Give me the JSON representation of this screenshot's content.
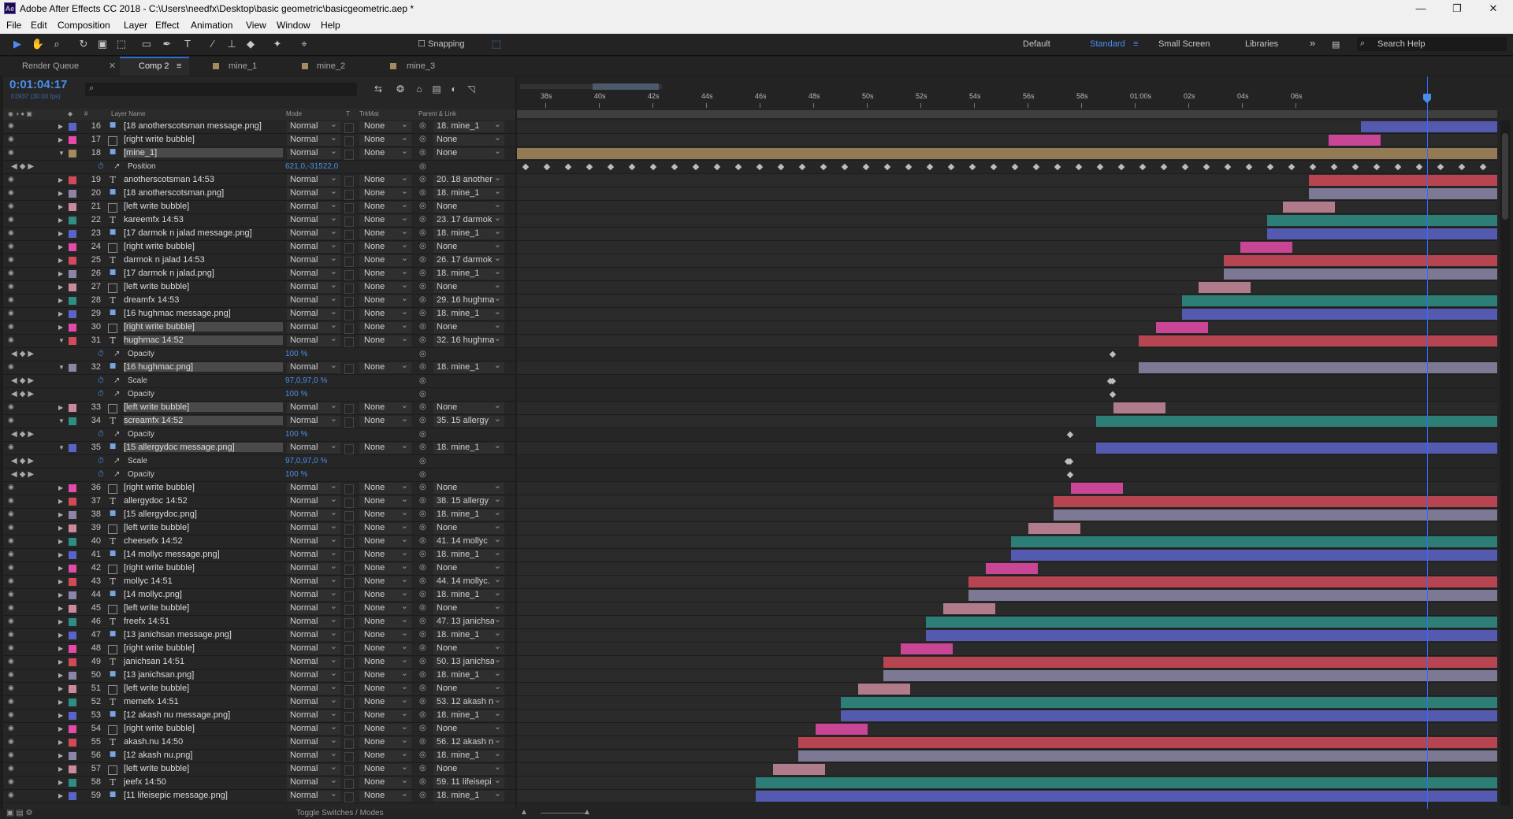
{
  "window": {
    "title": "Adobe After Effects CC 2018 - C:\\Users\\needfx\\Desktop\\basic geometric\\basicgeometric.aep *",
    "app_icon": "Ae"
  },
  "menu": [
    "File",
    "Edit",
    "Composition",
    "Layer",
    "Effect",
    "Animation",
    "View",
    "Window",
    "Help"
  ],
  "toolbar": {
    "snapping_label": "Snapping",
    "workspaces": [
      "Default",
      "Standard",
      "Small Screen",
      "Libraries"
    ],
    "active_workspace": "Standard",
    "search_placeholder": "Search Help",
    "more": "»"
  },
  "tabs": [
    "Render Queue",
    "Comp 2",
    "mine_1",
    "mine_2",
    "mine_3"
  ],
  "active_tab": "Comp 2",
  "comp": {
    "timecode": "0:01:04:17",
    "fps": "01937 (30.00 fps)"
  },
  "columns": {
    "layer_name": "Layer Name",
    "mode": "Mode",
    "t": "T",
    "trkmat": "TrkMat",
    "parent": "Parent & Link",
    "num": "#"
  },
  "ruler_ticks": [
    "38s",
    "40s",
    "42s",
    "44s",
    "46s",
    "48s",
    "50s",
    "52s",
    "54s",
    "56s",
    "58s",
    "01:00s",
    "02s",
    "04s",
    "06s"
  ],
  "colors": {
    "accent": "#4a8eea",
    "red": "#d04a58",
    "teal": "#2e8d85",
    "blue": "#5a63c8",
    "mauve": "#8c86a6",
    "pink": "#e54aa8",
    "lightpink": "#c88a9c",
    "tan": "#a48a5c"
  },
  "rows": [
    {
      "kind": "layer",
      "num": "16",
      "type": "png",
      "label": "blue",
      "name": "[18 anotherscotsman message.png]",
      "mode": "Normal",
      "trkmat": "None",
      "parent": "18. mine_1"
    },
    {
      "kind": "layer",
      "num": "17",
      "type": "img",
      "label": "pink",
      "name": "[right write bubble]",
      "mode": "Normal",
      "trkmat": "None",
      "parent": "None"
    },
    {
      "kind": "layer",
      "num": "18",
      "type": "png",
      "label": "tan",
      "name": "[mine_1]",
      "mode": "Normal",
      "trkmat": "None",
      "parent": "None",
      "open": true,
      "sel": true
    },
    {
      "kind": "prop",
      "prop": "Position",
      "value": "621,0,-31522,0"
    },
    {
      "kind": "layer",
      "num": "19",
      "type": "T",
      "label": "red",
      "name": "anotherscotsman  14:53",
      "mode": "Normal",
      "trkmat": "None",
      "parent": "20. 18 another"
    },
    {
      "kind": "layer",
      "num": "20",
      "type": "png",
      "label": "mauve",
      "name": "[18 anotherscotsman.png]",
      "mode": "Normal",
      "trkmat": "None",
      "parent": "18. mine_1"
    },
    {
      "kind": "layer",
      "num": "21",
      "type": "img",
      "label": "lightpink",
      "name": "[left write bubble]",
      "mode": "Normal",
      "trkmat": "None",
      "parent": "None"
    },
    {
      "kind": "layer",
      "num": "22",
      "type": "T",
      "label": "teal",
      "name": "kareemfx  14:53",
      "mode": "Normal",
      "trkmat": "None",
      "parent": "23. 17 darmok"
    },
    {
      "kind": "layer",
      "num": "23",
      "type": "png",
      "label": "blue",
      "name": "[17 darmok n jalad message.png]",
      "mode": "Normal",
      "trkmat": "None",
      "parent": "18. mine_1"
    },
    {
      "kind": "layer",
      "num": "24",
      "type": "img",
      "label": "pink",
      "name": "[right write bubble]",
      "mode": "Normal",
      "trkmat": "None",
      "parent": "None"
    },
    {
      "kind": "layer",
      "num": "25",
      "type": "T",
      "label": "red",
      "name": "darmok n jalad  14:53",
      "mode": "Normal",
      "trkmat": "None",
      "parent": "26. 17 darmok"
    },
    {
      "kind": "layer",
      "num": "26",
      "type": "png",
      "label": "mauve",
      "name": "[17 darmok n jalad.png]",
      "mode": "Normal",
      "trkmat": "None",
      "parent": "18. mine_1"
    },
    {
      "kind": "layer",
      "num": "27",
      "type": "img",
      "label": "lightpink",
      "name": "[left write bubble]",
      "mode": "Normal",
      "trkmat": "None",
      "parent": "None"
    },
    {
      "kind": "layer",
      "num": "28",
      "type": "T",
      "label": "teal",
      "name": "dreamfx  14:53",
      "mode": "Normal",
      "trkmat": "None",
      "parent": "29. 16 hughma"
    },
    {
      "kind": "layer",
      "num": "29",
      "type": "png",
      "label": "blue",
      "name": "[16 hughmac message.png]",
      "mode": "Normal",
      "trkmat": "None",
      "parent": "18. mine_1"
    },
    {
      "kind": "layer",
      "num": "30",
      "type": "img",
      "label": "pink",
      "name": "[right write bubble]",
      "mode": "Normal",
      "trkmat": "None",
      "parent": "None",
      "sel": true
    },
    {
      "kind": "layer",
      "num": "31",
      "type": "T",
      "label": "red",
      "name": "hughmac  14:52",
      "mode": "Normal",
      "trkmat": "None",
      "parent": "32. 16 hughma",
      "open": true,
      "sel": true
    },
    {
      "kind": "prop",
      "prop": "Opacity",
      "value": "100 %"
    },
    {
      "kind": "layer",
      "num": "32",
      "type": "png",
      "label": "mauve",
      "name": "[16 hughmac.png]",
      "mode": "Normal",
      "trkmat": "None",
      "parent": "18. mine_1",
      "open": true,
      "sel": true
    },
    {
      "kind": "prop",
      "prop": "Scale",
      "value": "97,0,97,0 %"
    },
    {
      "kind": "prop",
      "prop": "Opacity",
      "value": "100 %"
    },
    {
      "kind": "layer",
      "num": "33",
      "type": "img",
      "label": "lightpink",
      "name": "[left write bubble]",
      "mode": "Normal",
      "trkmat": "None",
      "parent": "None",
      "sel": true
    },
    {
      "kind": "layer",
      "num": "34",
      "type": "T",
      "label": "teal",
      "name": "screamfx  14:52",
      "mode": "Normal",
      "trkmat": "None",
      "parent": "35. 15 allergy",
      "open": true,
      "sel": true
    },
    {
      "kind": "prop",
      "prop": "Opacity",
      "value": "100 %"
    },
    {
      "kind": "layer",
      "num": "35",
      "type": "png",
      "label": "blue",
      "name": "[15 allergydoc message.png]",
      "mode": "Normal",
      "trkmat": "None",
      "parent": "18. mine_1",
      "open": true,
      "sel": true
    },
    {
      "kind": "prop",
      "prop": "Scale",
      "value": "97,0,97,0 %"
    },
    {
      "kind": "prop",
      "prop": "Opacity",
      "value": "100 %"
    },
    {
      "kind": "layer",
      "num": "36",
      "type": "img",
      "label": "pink",
      "name": "[right write bubble]",
      "mode": "Normal",
      "trkmat": "None",
      "parent": "None"
    },
    {
      "kind": "layer",
      "num": "37",
      "type": "T",
      "label": "red",
      "name": "allergydoc  14:52",
      "mode": "Normal",
      "trkmat": "None",
      "parent": "38. 15 allergy"
    },
    {
      "kind": "layer",
      "num": "38",
      "type": "png",
      "label": "mauve",
      "name": "[15 allergydoc.png]",
      "mode": "Normal",
      "trkmat": "None",
      "parent": "18. mine_1"
    },
    {
      "kind": "layer",
      "num": "39",
      "type": "img",
      "label": "lightpink",
      "name": "[left write bubble]",
      "mode": "Normal",
      "trkmat": "None",
      "parent": "None"
    },
    {
      "kind": "layer",
      "num": "40",
      "type": "T",
      "label": "teal",
      "name": "cheesefx  14:52",
      "mode": "Normal",
      "trkmat": "None",
      "parent": "41. 14 mollyc"
    },
    {
      "kind": "layer",
      "num": "41",
      "type": "png",
      "label": "blue",
      "name": "[14 mollyc message.png]",
      "mode": "Normal",
      "trkmat": "None",
      "parent": "18. mine_1"
    },
    {
      "kind": "layer",
      "num": "42",
      "type": "img",
      "label": "pink",
      "name": "[right write bubble]",
      "mode": "Normal",
      "trkmat": "None",
      "parent": "None"
    },
    {
      "kind": "layer",
      "num": "43",
      "type": "T",
      "label": "red",
      "name": "mollyc  14:51",
      "mode": "Normal",
      "trkmat": "None",
      "parent": "44. 14 mollyc."
    },
    {
      "kind": "layer",
      "num": "44",
      "type": "png",
      "label": "mauve",
      "name": "[14 mollyc.png]",
      "mode": "Normal",
      "trkmat": "None",
      "parent": "18. mine_1"
    },
    {
      "kind": "layer",
      "num": "45",
      "type": "img",
      "label": "lightpink",
      "name": "[left write bubble]",
      "mode": "Normal",
      "trkmat": "None",
      "parent": "None"
    },
    {
      "kind": "layer",
      "num": "46",
      "type": "T",
      "label": "teal",
      "name": "freefx  14:51",
      "mode": "Normal",
      "trkmat": "None",
      "parent": "47. 13 janichsa"
    },
    {
      "kind": "layer",
      "num": "47",
      "type": "png",
      "label": "blue",
      "name": "[13 janichsan message.png]",
      "mode": "Normal",
      "trkmat": "None",
      "parent": "18. mine_1"
    },
    {
      "kind": "layer",
      "num": "48",
      "type": "img",
      "label": "pink",
      "name": "[right write bubble]",
      "mode": "Normal",
      "trkmat": "None",
      "parent": "None"
    },
    {
      "kind": "layer",
      "num": "49",
      "type": "T",
      "label": "red",
      "name": "janichsan  14:51",
      "mode": "Normal",
      "trkmat": "None",
      "parent": "50. 13 janichsa"
    },
    {
      "kind": "layer",
      "num": "50",
      "type": "png",
      "label": "mauve",
      "name": "[13 janichsan.png]",
      "mode": "Normal",
      "trkmat": "None",
      "parent": "18. mine_1"
    },
    {
      "kind": "layer",
      "num": "51",
      "type": "img",
      "label": "lightpink",
      "name": "[left write bubble]",
      "mode": "Normal",
      "trkmat": "None",
      "parent": "None"
    },
    {
      "kind": "layer",
      "num": "52",
      "type": "T",
      "label": "teal",
      "name": "memefx  14:51",
      "mode": "Normal",
      "trkmat": "None",
      "parent": "53. 12 akash n"
    },
    {
      "kind": "layer",
      "num": "53",
      "type": "png",
      "label": "blue",
      "name": "[12 akash nu message.png]",
      "mode": "Normal",
      "trkmat": "None",
      "parent": "18. mine_1"
    },
    {
      "kind": "layer",
      "num": "54",
      "type": "img",
      "label": "pink",
      "name": "[right write bubble]",
      "mode": "Normal",
      "trkmat": "None",
      "parent": "None"
    },
    {
      "kind": "layer",
      "num": "55",
      "type": "T",
      "label": "red",
      "name": "akash.nu  14:50",
      "mode": "Normal",
      "trkmat": "None",
      "parent": "56. 12 akash n"
    },
    {
      "kind": "layer",
      "num": "56",
      "type": "png",
      "label": "mauve",
      "name": "[12 akash nu.png]",
      "mode": "Normal",
      "trkmat": "None",
      "parent": "18. mine_1"
    },
    {
      "kind": "layer",
      "num": "57",
      "type": "img",
      "label": "lightpink",
      "name": "[left write bubble]",
      "mode": "Normal",
      "trkmat": "None",
      "parent": "None"
    },
    {
      "kind": "layer",
      "num": "58",
      "type": "T",
      "label": "teal",
      "name": "jeefx  14:50",
      "mode": "Normal",
      "trkmat": "None",
      "parent": "59. 11 lifeisepi"
    },
    {
      "kind": "layer",
      "num": "59",
      "type": "png",
      "label": "blue",
      "name": "[11 lifeisepic message.png]",
      "mode": "Normal",
      "trkmat": "None",
      "parent": "18. mine_1"
    }
  ],
  "bottom": {
    "toggle": "Toggle Switches / Modes"
  }
}
